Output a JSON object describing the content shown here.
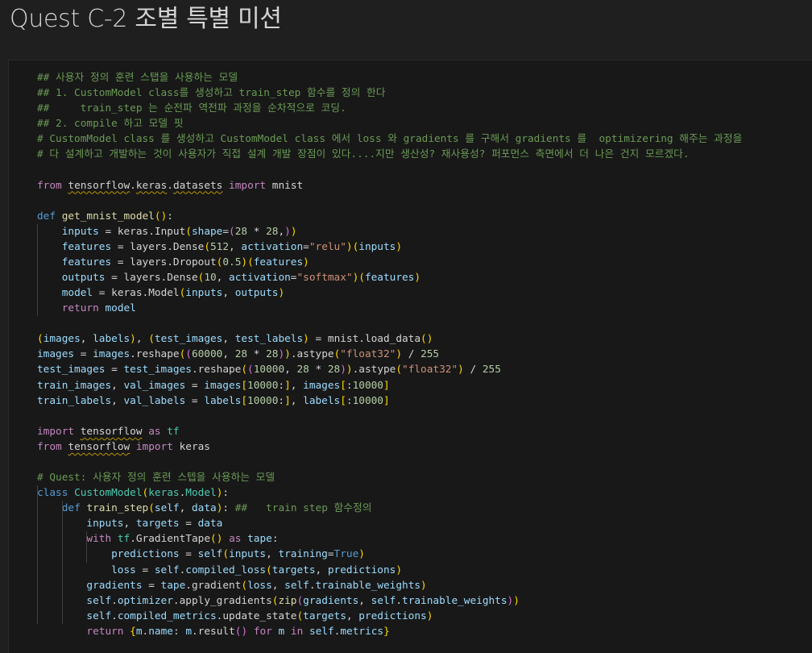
{
  "page": {
    "title": "Quest C-2 조별 특별 미션"
  },
  "colors": {
    "background": "#1f1f1f",
    "cell_background": "#181818",
    "comment": "#6a9955",
    "keyword": "#569cd6",
    "control_keyword": "#c586c0",
    "function": "#dcdcaa",
    "class": "#4ec9b0",
    "variable": "#9cdcfe",
    "string": "#ce9178",
    "number": "#b5cea8",
    "bracket_level_1": "#ffd700",
    "bracket_level_2": "#da70d6",
    "bracket_level_3": "#179fff",
    "unicode_highlight": "#b89500"
  },
  "code_cell": {
    "language": "python",
    "lines": [
      [
        {
          "t": "## 사용자 정의 훈련 스탭을 사용하는 모델",
          "k": "c"
        }
      ],
      [
        {
          "t": "## 1. CustomModel class를 생성하고 train_step 함수를 정의 한다",
          "k": "c"
        }
      ],
      [
        {
          "t": "##     train_step 는 순전파 역전파 과정을 순차적으로 코딩.",
          "k": "c"
        }
      ],
      [
        {
          "t": "## 2. compile 하고 모델 핏",
          "k": "c"
        }
      ],
      [
        {
          "t": "# CustomModel class 를 생성하고 CustomModel class 에서 loss 와 gradients 를 구해서 gradients 를  optimizering 해주는 과정을",
          "k": "c"
        }
      ],
      [
        {
          "t": "# 다 설계하고 개발하는 것이 사용자가 직접 설계 개발 장점이 있다....지만 생산성? 재사용성? 퍼포먼스 측면에서 더 나은 건지 모르겠다.",
          "k": "c"
        }
      ],
      [],
      [
        {
          "t": "from",
          "k": "kf"
        },
        {
          "t": " "
        },
        {
          "t": "tensorflow",
          "k": "p",
          "u": true
        },
        {
          "t": "."
        },
        {
          "t": "keras",
          "k": "p",
          "u": true
        },
        {
          "t": "."
        },
        {
          "t": "datasets",
          "k": "p",
          "u": true
        },
        {
          "t": " "
        },
        {
          "t": "import",
          "k": "kf"
        },
        {
          "t": " mnist"
        }
      ],
      [],
      [
        {
          "t": "def",
          "k": "kc"
        },
        {
          "t": " "
        },
        {
          "t": "get_mnist_model",
          "k": "fn"
        },
        {
          "t": "(",
          "k": "b1"
        },
        {
          "t": ")",
          "k": "b1"
        },
        {
          "t": ":"
        }
      ],
      [
        {
          "t": "    "
        },
        {
          "t": "inputs",
          "k": "v"
        },
        {
          "t": " = "
        },
        {
          "t": "keras",
          "k": "p"
        },
        {
          "t": "."
        },
        {
          "t": "Input",
          "k": "p"
        },
        {
          "t": "(",
          "k": "b1"
        },
        {
          "t": "shape",
          "k": "v"
        },
        {
          "t": "="
        },
        {
          "t": "(",
          "k": "b2"
        },
        {
          "t": "28",
          "k": "n"
        },
        {
          "t": " * "
        },
        {
          "t": "28",
          "k": "n"
        },
        {
          "t": ",",
          "k": "p"
        },
        {
          "t": ")",
          "k": "b2"
        },
        {
          "t": ")",
          "k": "b1"
        }
      ],
      [
        {
          "t": "    "
        },
        {
          "t": "features",
          "k": "v"
        },
        {
          "t": " = "
        },
        {
          "t": "layers",
          "k": "p"
        },
        {
          "t": "."
        },
        {
          "t": "Dense",
          "k": "p"
        },
        {
          "t": "(",
          "k": "b1"
        },
        {
          "t": "512",
          "k": "n"
        },
        {
          "t": ", "
        },
        {
          "t": "activation",
          "k": "v"
        },
        {
          "t": "="
        },
        {
          "t": "\"relu\"",
          "k": "s"
        },
        {
          "t": ")",
          "k": "b1"
        },
        {
          "t": "(",
          "k": "b1"
        },
        {
          "t": "inputs",
          "k": "v"
        },
        {
          "t": ")",
          "k": "b1"
        }
      ],
      [
        {
          "t": "    "
        },
        {
          "t": "features",
          "k": "v"
        },
        {
          "t": " = "
        },
        {
          "t": "layers",
          "k": "p"
        },
        {
          "t": "."
        },
        {
          "t": "Dropout",
          "k": "p"
        },
        {
          "t": "(",
          "k": "b1"
        },
        {
          "t": "0.5",
          "k": "n"
        },
        {
          "t": ")",
          "k": "b1"
        },
        {
          "t": "(",
          "k": "b1"
        },
        {
          "t": "features",
          "k": "v"
        },
        {
          "t": ")",
          "k": "b1"
        }
      ],
      [
        {
          "t": "    "
        },
        {
          "t": "outputs",
          "k": "v"
        },
        {
          "t": " = "
        },
        {
          "t": "layers",
          "k": "p"
        },
        {
          "t": "."
        },
        {
          "t": "Dense",
          "k": "p"
        },
        {
          "t": "(",
          "k": "b1"
        },
        {
          "t": "10",
          "k": "n"
        },
        {
          "t": ", "
        },
        {
          "t": "activation",
          "k": "v"
        },
        {
          "t": "="
        },
        {
          "t": "\"softmax\"",
          "k": "s"
        },
        {
          "t": ")",
          "k": "b1"
        },
        {
          "t": "(",
          "k": "b1"
        },
        {
          "t": "features",
          "k": "v"
        },
        {
          "t": ")",
          "k": "b1"
        }
      ],
      [
        {
          "t": "    "
        },
        {
          "t": "model",
          "k": "v"
        },
        {
          "t": " = "
        },
        {
          "t": "keras",
          "k": "p"
        },
        {
          "t": "."
        },
        {
          "t": "Model",
          "k": "p"
        },
        {
          "t": "(",
          "k": "b1"
        },
        {
          "t": "inputs",
          "k": "v"
        },
        {
          "t": ", "
        },
        {
          "t": "outputs",
          "k": "v"
        },
        {
          "t": ")",
          "k": "b1"
        }
      ],
      [
        {
          "t": "    "
        },
        {
          "t": "return",
          "k": "kf"
        },
        {
          "t": " "
        },
        {
          "t": "model",
          "k": "v"
        }
      ],
      [],
      [
        {
          "t": "(",
          "k": "b1"
        },
        {
          "t": "images",
          "k": "v"
        },
        {
          "t": ", "
        },
        {
          "t": "labels",
          "k": "v"
        },
        {
          "t": ")",
          "k": "b1"
        },
        {
          "t": ", "
        },
        {
          "t": "(",
          "k": "b1"
        },
        {
          "t": "test_images",
          "k": "v"
        },
        {
          "t": ", "
        },
        {
          "t": "test_labels",
          "k": "v"
        },
        {
          "t": ")",
          "k": "b1"
        },
        {
          "t": " = mnist.load_data"
        },
        {
          "t": "(",
          "k": "b1"
        },
        {
          "t": ")",
          "k": "b1"
        }
      ],
      [
        {
          "t": "images",
          "k": "v"
        },
        {
          "t": " = "
        },
        {
          "t": "images",
          "k": "v"
        },
        {
          "t": ".reshape"
        },
        {
          "t": "(",
          "k": "b1"
        },
        {
          "t": "(",
          "k": "b2"
        },
        {
          "t": "60000",
          "k": "n"
        },
        {
          "t": ", "
        },
        {
          "t": "28",
          "k": "n"
        },
        {
          "t": " * "
        },
        {
          "t": "28",
          "k": "n"
        },
        {
          "t": ")",
          "k": "b2"
        },
        {
          "t": ")",
          "k": "b1"
        },
        {
          "t": ".astype"
        },
        {
          "t": "(",
          "k": "b1"
        },
        {
          "t": "\"float32\"",
          "k": "s"
        },
        {
          "t": ")",
          "k": "b1"
        },
        {
          "t": " / "
        },
        {
          "t": "255",
          "k": "n"
        }
      ],
      [
        {
          "t": "test_images",
          "k": "v"
        },
        {
          "t": " = "
        },
        {
          "t": "test_images",
          "k": "v"
        },
        {
          "t": ".reshape"
        },
        {
          "t": "(",
          "k": "b1"
        },
        {
          "t": "(",
          "k": "b2"
        },
        {
          "t": "10000",
          "k": "n"
        },
        {
          "t": ", "
        },
        {
          "t": "28",
          "k": "n"
        },
        {
          "t": " * "
        },
        {
          "t": "28",
          "k": "n"
        },
        {
          "t": ")",
          "k": "b2"
        },
        {
          "t": ")",
          "k": "b1"
        },
        {
          "t": ".astype"
        },
        {
          "t": "(",
          "k": "b1"
        },
        {
          "t": "\"float32\"",
          "k": "s"
        },
        {
          "t": ")",
          "k": "b1"
        },
        {
          "t": " / "
        },
        {
          "t": "255",
          "k": "n"
        }
      ],
      [
        {
          "t": "train_images",
          "k": "v"
        },
        {
          "t": ", "
        },
        {
          "t": "val_images",
          "k": "v"
        },
        {
          "t": " = "
        },
        {
          "t": "images",
          "k": "v"
        },
        {
          "t": "[",
          "k": "b1"
        },
        {
          "t": "10000",
          "k": "n"
        },
        {
          "t": ":"
        },
        {
          "t": "]",
          "k": "b1"
        },
        {
          "t": ", "
        },
        {
          "t": "images",
          "k": "v"
        },
        {
          "t": "[",
          "k": "b1"
        },
        {
          "t": ":"
        },
        {
          "t": "10000",
          "k": "n"
        },
        {
          "t": "]",
          "k": "b1"
        }
      ],
      [
        {
          "t": "train_labels",
          "k": "v"
        },
        {
          "t": ", "
        },
        {
          "t": "val_labels",
          "k": "v"
        },
        {
          "t": " = "
        },
        {
          "t": "labels",
          "k": "v"
        },
        {
          "t": "[",
          "k": "b1"
        },
        {
          "t": "10000",
          "k": "n"
        },
        {
          "t": ":"
        },
        {
          "t": "]",
          "k": "b1"
        },
        {
          "t": ", "
        },
        {
          "t": "labels",
          "k": "v"
        },
        {
          "t": "[",
          "k": "b1"
        },
        {
          "t": ":"
        },
        {
          "t": "10000",
          "k": "n"
        },
        {
          "t": "]",
          "k": "b1"
        }
      ],
      [],
      [
        {
          "t": "import",
          "k": "kf"
        },
        {
          "t": " "
        },
        {
          "t": "tensorflow",
          "k": "p",
          "u": true
        },
        {
          "t": " "
        },
        {
          "t": "as",
          "k": "kf"
        },
        {
          "t": " "
        },
        {
          "t": "tf",
          "k": "cls"
        }
      ],
      [
        {
          "t": "from",
          "k": "kf"
        },
        {
          "t": " "
        },
        {
          "t": "tensorflow",
          "k": "p",
          "u": true
        },
        {
          "t": " "
        },
        {
          "t": "import",
          "k": "kf"
        },
        {
          "t": " keras"
        }
      ],
      [],
      [
        {
          "t": "# Quest: 사용자 정의 훈련 스텝을 사용하는 모델",
          "k": "c"
        }
      ],
      [
        {
          "t": "class",
          "k": "kc"
        },
        {
          "t": " "
        },
        {
          "t": "CustomModel",
          "k": "cls"
        },
        {
          "t": "(",
          "k": "b1"
        },
        {
          "t": "keras",
          "k": "cls"
        },
        {
          "t": ".",
          "k": "p"
        },
        {
          "t": "Model",
          "k": "cls"
        },
        {
          "t": ")",
          "k": "b1"
        },
        {
          "t": ":"
        }
      ],
      [
        {
          "t": "    "
        },
        {
          "t": "def",
          "k": "kc"
        },
        {
          "t": " "
        },
        {
          "t": "train_step",
          "k": "fn"
        },
        {
          "t": "(",
          "k": "b1"
        },
        {
          "t": "self",
          "k": "v"
        },
        {
          "t": ", "
        },
        {
          "t": "data",
          "k": "v"
        },
        {
          "t": ")",
          "k": "b1"
        },
        {
          "t": ": "
        },
        {
          "t": "##   train step 함수정의",
          "k": "c"
        }
      ],
      [
        {
          "t": "        "
        },
        {
          "t": "inputs",
          "k": "v"
        },
        {
          "t": ", "
        },
        {
          "t": "targets",
          "k": "v"
        },
        {
          "t": " = "
        },
        {
          "t": "data",
          "k": "v"
        }
      ],
      [
        {
          "t": "        "
        },
        {
          "t": "with",
          "k": "kf"
        },
        {
          "t": " "
        },
        {
          "t": "tf",
          "k": "cls"
        },
        {
          "t": "."
        },
        {
          "t": "GradientTape",
          "k": "p"
        },
        {
          "t": "(",
          "k": "b1"
        },
        {
          "t": ")",
          "k": "b1"
        },
        {
          "t": " "
        },
        {
          "t": "as",
          "k": "kf"
        },
        {
          "t": " "
        },
        {
          "t": "tape",
          "k": "v"
        },
        {
          "t": ":"
        }
      ],
      [
        {
          "t": "            "
        },
        {
          "t": "predictions",
          "k": "v"
        },
        {
          "t": " = "
        },
        {
          "t": "self",
          "k": "v"
        },
        {
          "t": "(",
          "k": "b1"
        },
        {
          "t": "inputs",
          "k": "v"
        },
        {
          "t": ", "
        },
        {
          "t": "training",
          "k": "v"
        },
        {
          "t": "="
        },
        {
          "t": "True",
          "k": "kc"
        },
        {
          "t": ")",
          "k": "b1"
        }
      ],
      [
        {
          "t": "            "
        },
        {
          "t": "loss",
          "k": "v"
        },
        {
          "t": " = "
        },
        {
          "t": "self",
          "k": "v"
        },
        {
          "t": "."
        },
        {
          "t": "compiled_loss",
          "k": "v"
        },
        {
          "t": "(",
          "k": "b1"
        },
        {
          "t": "targets",
          "k": "v"
        },
        {
          "t": ", "
        },
        {
          "t": "predictions",
          "k": "v"
        },
        {
          "t": ")",
          "k": "b1"
        }
      ],
      [
        {
          "t": "        "
        },
        {
          "t": "gradients",
          "k": "v"
        },
        {
          "t": " = "
        },
        {
          "t": "tape",
          "k": "v"
        },
        {
          "t": "."
        },
        {
          "t": "gradient",
          "k": "p"
        },
        {
          "t": "(",
          "k": "b1"
        },
        {
          "t": "loss",
          "k": "v"
        },
        {
          "t": ", "
        },
        {
          "t": "self",
          "k": "v"
        },
        {
          "t": "."
        },
        {
          "t": "trainable_weights",
          "k": "v"
        },
        {
          "t": ")",
          "k": "b1"
        }
      ],
      [
        {
          "t": "        "
        },
        {
          "t": "self",
          "k": "v"
        },
        {
          "t": "."
        },
        {
          "t": "optimizer",
          "k": "v"
        },
        {
          "t": "."
        },
        {
          "t": "apply_gradients",
          "k": "p"
        },
        {
          "t": "(",
          "k": "b1"
        },
        {
          "t": "zip",
          "k": "fn"
        },
        {
          "t": "(",
          "k": "b2"
        },
        {
          "t": "gradients",
          "k": "v"
        },
        {
          "t": ", "
        },
        {
          "t": "self",
          "k": "v"
        },
        {
          "t": "."
        },
        {
          "t": "trainable_weights",
          "k": "v"
        },
        {
          "t": ")",
          "k": "b2"
        },
        {
          "t": ")",
          "k": "b1"
        }
      ],
      [
        {
          "t": "        "
        },
        {
          "t": "self",
          "k": "v"
        },
        {
          "t": "."
        },
        {
          "t": "compiled_metrics",
          "k": "v"
        },
        {
          "t": "."
        },
        {
          "t": "update_state",
          "k": "p"
        },
        {
          "t": "(",
          "k": "b1"
        },
        {
          "t": "targets",
          "k": "v"
        },
        {
          "t": ", "
        },
        {
          "t": "predictions",
          "k": "v"
        },
        {
          "t": ")",
          "k": "b1"
        }
      ],
      [
        {
          "t": "        "
        },
        {
          "t": "return",
          "k": "kf"
        },
        {
          "t": " "
        },
        {
          "t": "{",
          "k": "b1"
        },
        {
          "t": "m",
          "k": "v"
        },
        {
          "t": "."
        },
        {
          "t": "name",
          "k": "v"
        },
        {
          "t": ": "
        },
        {
          "t": "m",
          "k": "v"
        },
        {
          "t": "."
        },
        {
          "t": "result",
          "k": "p"
        },
        {
          "t": "(",
          "k": "b2"
        },
        {
          "t": ")",
          "k": "b2"
        },
        {
          "t": " "
        },
        {
          "t": "for",
          "k": "kf"
        },
        {
          "t": " "
        },
        {
          "t": "m",
          "k": "v"
        },
        {
          "t": " "
        },
        {
          "t": "in",
          "k": "kf"
        },
        {
          "t": " "
        },
        {
          "t": "self",
          "k": "v"
        },
        {
          "t": "."
        },
        {
          "t": "metrics",
          "k": "v"
        },
        {
          "t": "}",
          "k": "b1"
        }
      ]
    ]
  }
}
